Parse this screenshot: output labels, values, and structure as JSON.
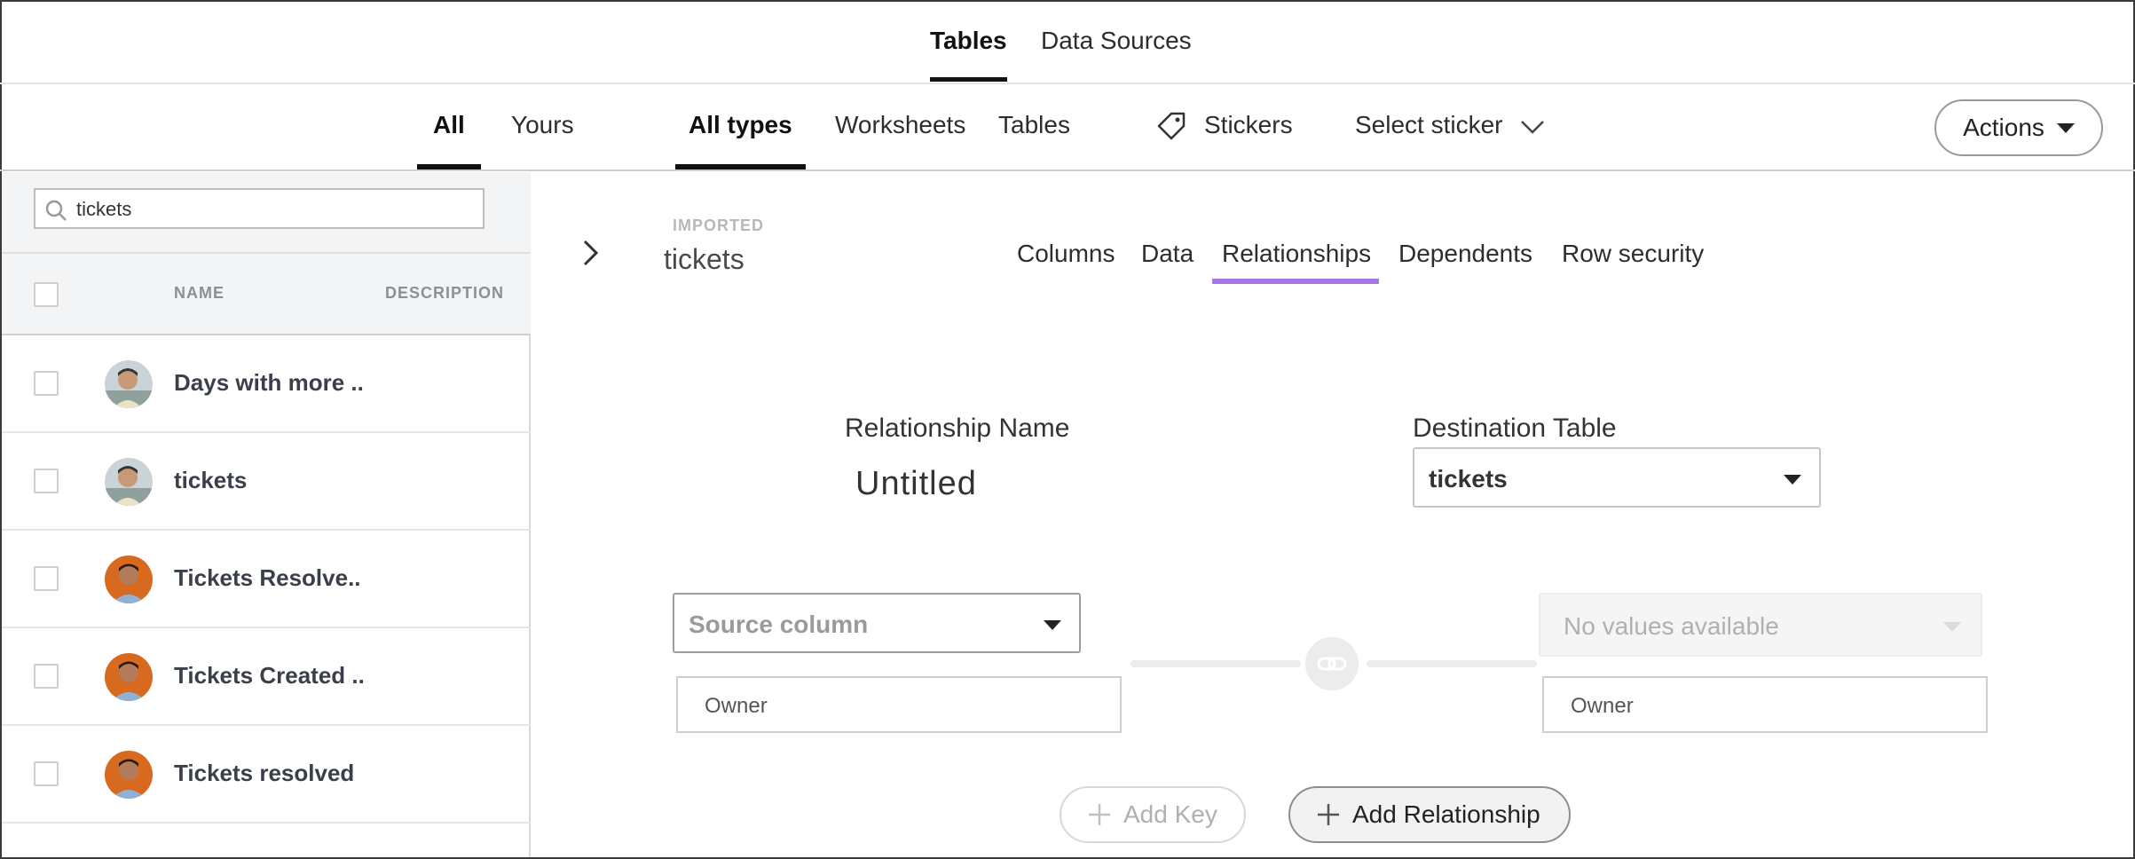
{
  "top_tabs": [
    {
      "label": "Tables",
      "active": true
    },
    {
      "label": "Data Sources",
      "active": false
    }
  ],
  "ownership_filters": [
    {
      "label": "All",
      "active": true
    },
    {
      "label": "Yours",
      "active": false
    }
  ],
  "type_filters": [
    {
      "label": "All types",
      "active": true
    },
    {
      "label": "Worksheets",
      "active": false
    },
    {
      "label": "Tables",
      "active": false
    }
  ],
  "stickers": {
    "label": "Stickers",
    "icon": "tag-icon",
    "select_label": "Select sticker"
  },
  "actions_label": "Actions",
  "search": {
    "value": "tickets"
  },
  "list": {
    "columns": [
      "NAME",
      "DESCRIPTION"
    ],
    "rows": [
      {
        "name": "Days with more ..",
        "avatar": "avatar-1"
      },
      {
        "name": "tickets",
        "avatar": "avatar-1"
      },
      {
        "name": "Tickets Resolve..",
        "avatar": "avatar-2"
      },
      {
        "name": "Tickets Created ..",
        "avatar": "avatar-2"
      },
      {
        "name": "Tickets resolved",
        "avatar": "avatar-2"
      }
    ]
  },
  "detail": {
    "badge": "IMPORTED",
    "title": "tickets",
    "tabs": [
      {
        "label": "Columns",
        "active": false
      },
      {
        "label": "Data",
        "active": false
      },
      {
        "label": "Relationships",
        "active": true
      },
      {
        "label": "Dependents",
        "active": false
      },
      {
        "label": "Row security",
        "active": false
      }
    ],
    "accent_color": "#a476e6"
  },
  "relationship": {
    "name_label": "Relationship Name",
    "name_value": "Untitled",
    "dest_label": "Destination Table",
    "dest_value": "tickets",
    "source_placeholder": "Source column",
    "dest_column_placeholder": "No values available",
    "source_owner": "Owner",
    "dest_owner": "Owner",
    "add_key_label": "Add Key",
    "add_relationship_label": "Add Relationship"
  }
}
